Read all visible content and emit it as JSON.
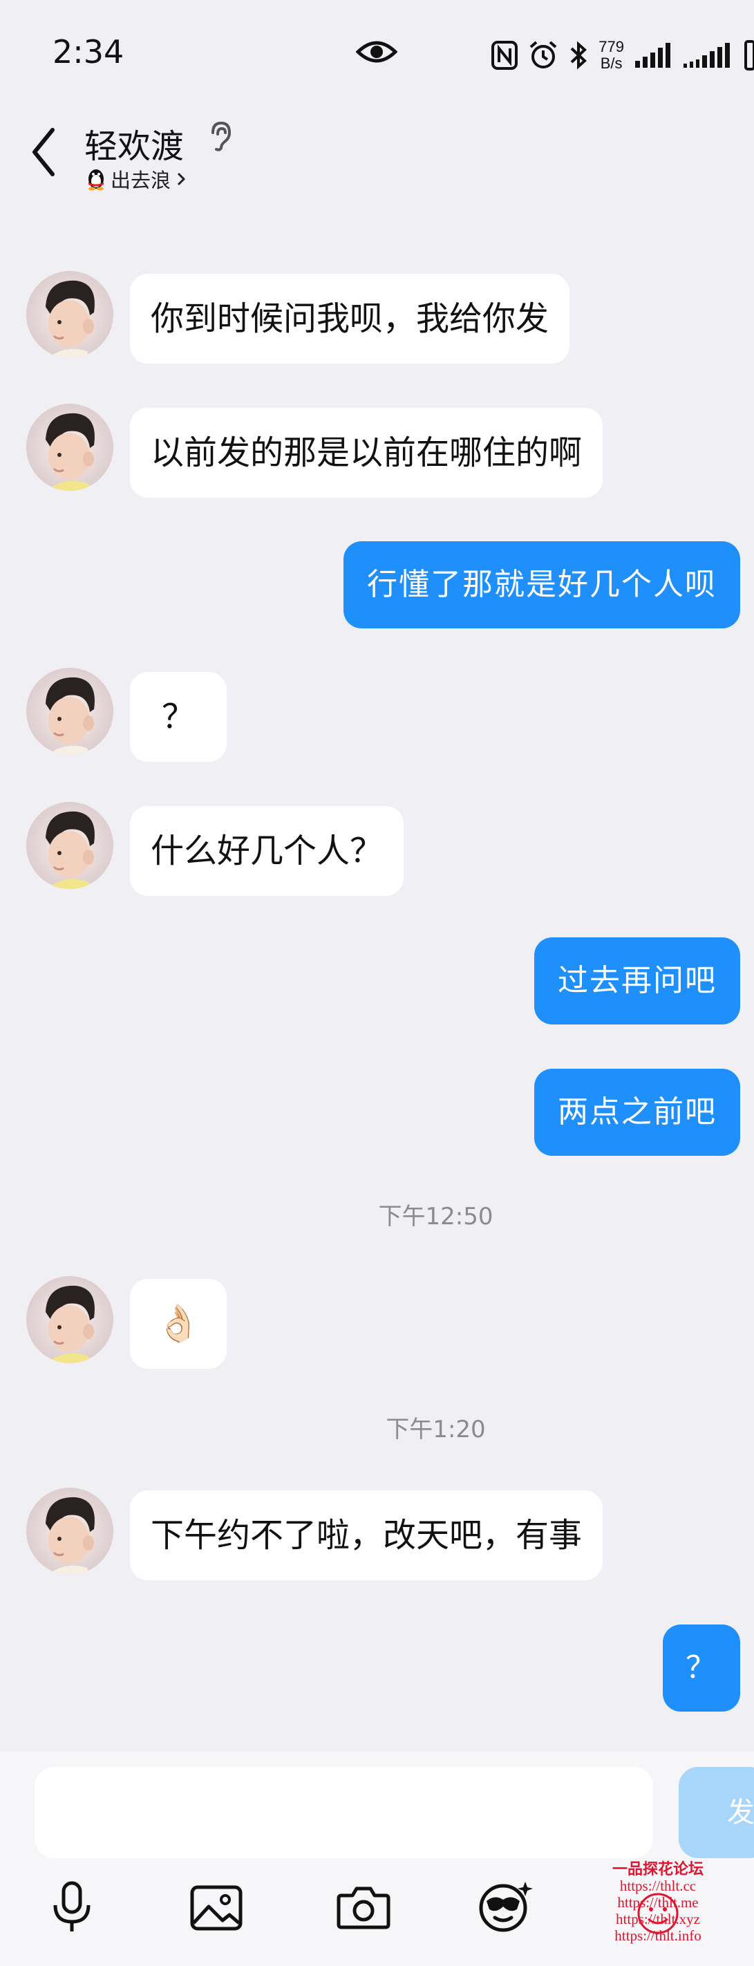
{
  "status_bar": {
    "time": "2:34",
    "net_speed_value": "779",
    "net_speed_unit": "B/s"
  },
  "header": {
    "contact_name": "轻欢渡",
    "status_text": "出去浪"
  },
  "messages": [
    {
      "from": "them",
      "text": "你到时候问我呗，我给你发"
    },
    {
      "from": "them",
      "text": "以前发的那是以前在哪住的啊"
    },
    {
      "from": "me",
      "text": "行懂了那就是好几个人呗"
    },
    {
      "from": "them",
      "text": "？"
    },
    {
      "from": "them",
      "text": "什么好几个人？"
    },
    {
      "from": "me",
      "text": "过去再问吧"
    },
    {
      "from": "me",
      "text": "两点之前吧"
    },
    {
      "timestamp": "下午12:50"
    },
    {
      "from": "them",
      "text": "👌🏻"
    },
    {
      "timestamp": "下午1:20"
    },
    {
      "from": "them",
      "text": "下午约不了啦，改天吧，有事"
    },
    {
      "from": "me",
      "text": "？"
    }
  ],
  "input": {
    "send_label": "发"
  },
  "watermark": {
    "title": "一品探花论坛",
    "lines": [
      "https://thlt.cc",
      "https://thlt.me",
      "https://thlt.xyz",
      "https://thlt.info"
    ]
  },
  "colors": {
    "background": "#efeff4",
    "outgoing_bubble": "#1f8ffb",
    "incoming_bubble": "#ffffff",
    "send_button": "#a8d6fb"
  }
}
